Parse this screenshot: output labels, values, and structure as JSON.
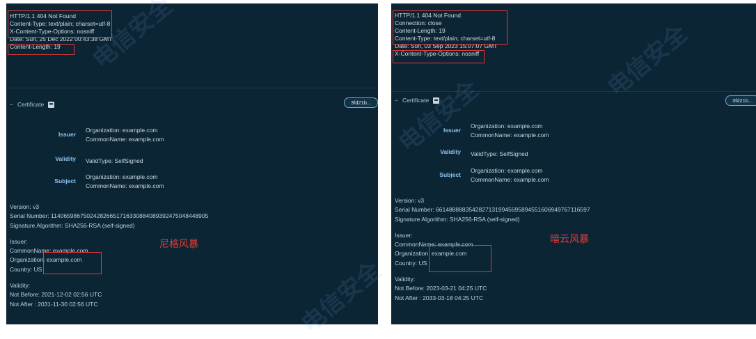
{
  "left": {
    "headers": [
      "HTTP/1.1 404 Not Found",
      "Content-Type: text/plain; charset=utf-8",
      "X-Content-Type-Options: nosniff",
      "Date: Sun, 25 Dec 2022 00:43:38 GMT",
      "Content-Length: 19"
    ],
    "cert_title": "Certificate",
    "hash": "3fd21b...",
    "issuer_label": "Issuer",
    "issuer_values": [
      "Organization: example.com",
      "CommonName: example.com"
    ],
    "validity_label": "Validity",
    "validity_value": "ValidType: SelfSigned",
    "subject_label": "Subject",
    "subject_values": [
      "Organization: example.com",
      "CommonName: example.com"
    ],
    "version": "Version: v3",
    "serial": "Serial Number: 114065986750242826651716330884089392475048448905",
    "sigalg": "Signature Algorithm: SHA256-RSA (self-signed)",
    "issuer_head": "Issuer:",
    "issuer_cn": "CommonName: example.com",
    "issuer_org": "Organization: example.com",
    "country": "Country: US",
    "validity_head": "Validity:",
    "not_before": "Not Before: 2021-12-02 02:56 UTC",
    "not_after": "Not After : 2031-11-30 02:56 UTC",
    "annotation": "尼格风暴"
  },
  "right": {
    "headers": [
      "HTTP/1.1 404 Not Found",
      "Connection: close",
      "Content-Length: 19",
      "Content-Type: text/plain; charset=utf-8",
      "Date: Sun, 03 Sep 2023 15:07:07 GMT",
      "X-Content-Type-Options: nosniff"
    ],
    "cert_title": "Certificate",
    "hash": "3fd21b...",
    "issuer_label": "Issuer",
    "issuer_values": [
      "Organization: example.com",
      "CommonName: example.com"
    ],
    "validity_label": "Validity",
    "validity_value": "ValidType: SelfSigned",
    "subject_label": "Subject",
    "subject_values": [
      "Organization: example.com",
      "CommonName: example.com"
    ],
    "version": "Version: v3",
    "serial": "Serial Number: 66148888835428271319945695894551606949767116597",
    "sigalg": "Signature Algorithm: SHA256-RSA (self-signed)",
    "issuer_head": "Issuer:",
    "issuer_cn": "CommonName: example.com",
    "issuer_org": "Organization: example.com",
    "country": "Country: US",
    "validity_head": "Validity:",
    "not_before": "Not Before: 2023-03-21 04:25 UTC",
    "not_after": "Not After : 2033-03-18 04:25 UTC",
    "annotation": "暗云风暴"
  },
  "watermark": "电信安全",
  "colors": {
    "panel_bg": "#0c2535",
    "highlight": "#e53935",
    "label_blue": "#8ec3ee"
  }
}
